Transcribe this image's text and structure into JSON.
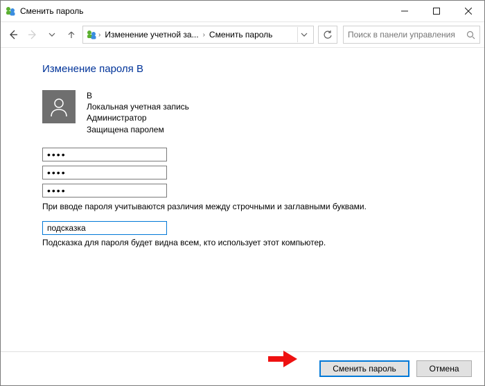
{
  "titlebar": {
    "title": "Сменить пароль"
  },
  "breadcrumb": {
    "level1": "Изменение учетной за...",
    "level2": "Сменить пароль"
  },
  "search": {
    "placeholder": "Поиск в панели управления"
  },
  "page": {
    "heading": "Изменение пароля В",
    "user": {
      "name": "В",
      "account_type": "Локальная учетная запись",
      "role": "Администратор",
      "protection": "Защищена паролем"
    },
    "passwords": {
      "current": "••••",
      "new": "••••",
      "confirm": "••••"
    },
    "case_note": "При вводе пароля учитываются различия между строчными и заглавными буквами.",
    "hint_value": "подсказка",
    "hint_note": "Подсказка для пароля будет видна всем, кто использует этот компьютер."
  },
  "buttons": {
    "primary": "Сменить пароль",
    "cancel": "Отмена"
  }
}
